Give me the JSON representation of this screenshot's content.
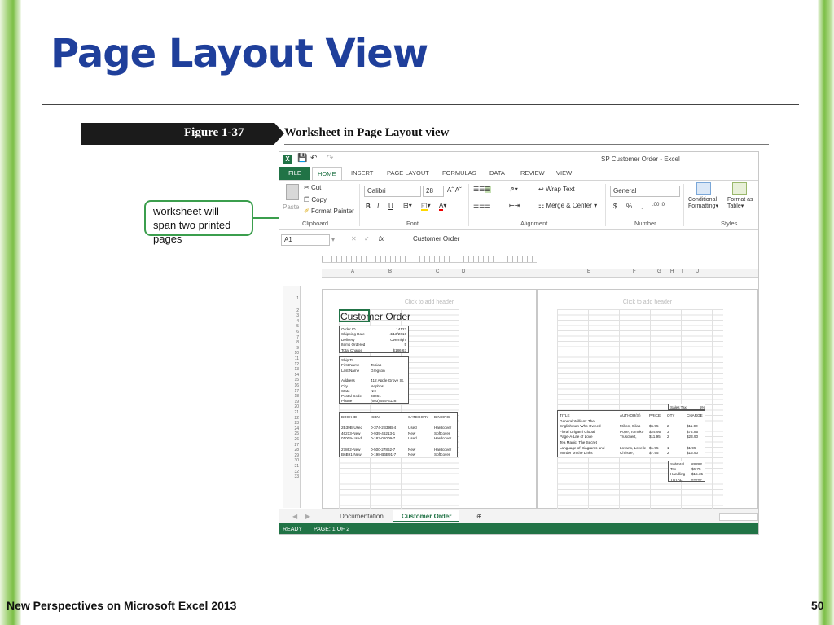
{
  "slide": {
    "title": "Page Layout View",
    "footer": "New Perspectives on Microsoft Excel 2013",
    "page_number": "50",
    "figure_number": "Figure 1-37",
    "figure_caption": "Worksheet in Page Layout view",
    "callout": "worksheet will span two printed pages"
  },
  "excel": {
    "window_title": "SP Customer Order - Excel",
    "tabs": [
      "FILE",
      "HOME",
      "INSERT",
      "PAGE LAYOUT",
      "FORMULAS",
      "DATA",
      "REVIEW",
      "VIEW"
    ],
    "clipboard": {
      "paste": "Paste",
      "cut": "Cut",
      "copy": "Copy",
      "format_painter": "Format Painter",
      "label": "Clipboard"
    },
    "font": {
      "name": "Calibri",
      "size": "28",
      "label": "Font",
      "bold": "B",
      "italic": "I",
      "underline": "U"
    },
    "alignment": {
      "wrap": "Wrap Text",
      "merge": "Merge & Center",
      "label": "Alignment"
    },
    "number": {
      "format": "General",
      "currency": "$",
      "percent": "%",
      "comma": ",",
      "label": "Number"
    },
    "styles": {
      "conditional": "Conditional",
      "formatting": "Formatting",
      "format_as": "Format as",
      "table": "Table",
      "label": "Styles"
    },
    "name_box": "A1",
    "fx": "fx",
    "formula": "Customer Order",
    "columns_left": [
      "A",
      "B",
      "C",
      "D"
    ],
    "columns_right": [
      "E",
      "F",
      "G",
      "H",
      "I",
      "J"
    ],
    "header_placeholder": "Click to add header",
    "sheet_tabs": [
      "Documentation",
      "Customer Order"
    ],
    "status": "READY",
    "page_info": "PAGE: 1 OF 2"
  },
  "worksheet": {
    "title": "Customer Order",
    "order_info": [
      [
        "Order ID",
        "14123"
      ],
      [
        "Shipping Date",
        "4/13/2016"
      ],
      [
        "Delivery",
        "Overnight"
      ],
      [
        "Items Ordered",
        "5"
      ],
      [
        "Total Charge",
        "$186.63"
      ]
    ],
    "ship_to": [
      [
        "Ship To",
        ""
      ],
      [
        "First Name",
        "Tobias"
      ],
      [
        "Last Name",
        "Gregson"
      ],
      [
        "",
        ""
      ],
      [
        "Address",
        "412 Apple Grove St."
      ],
      [
        "City",
        "Nephos"
      ],
      [
        "State",
        "NH"
      ],
      [
        "Postal Code",
        "03061"
      ],
      [
        "Phone",
        "(603) 555-4128"
      ]
    ],
    "books_header": [
      "BOOK ID",
      "ISBN",
      "CATEGORY",
      "BINDING"
    ],
    "books": [
      [
        "2B39B-Used",
        "0-374-2B39B-4",
        "Used",
        "Hardcover"
      ],
      [
        "46213-New",
        "0-939-46213-1",
        "New",
        "Softcover"
      ],
      [
        "01009-Used",
        "0-183-01009-7",
        "Used",
        "Hardcover"
      ],
      [
        "",
        ""
      ],
      [
        "27862-New",
        "0-500-27862-7",
        "New",
        "Hardcover"
      ],
      [
        "B6B91-New",
        "0-198-B6B91-7",
        "New",
        "Softcover"
      ]
    ],
    "titles_header": [
      "TITLE",
      "AUTHOR(S)",
      "PRICE",
      "QTY",
      "CHARGE"
    ],
    "titles": [
      [
        "General William: The",
        "",
        "",
        "",
        ""
      ],
      [
        "Englishman Who Owned",
        "Milton, Gilas",
        "$5.95",
        "2",
        "$11.90"
      ],
      [
        "Floral Origami Global",
        "Pope, Tomoko",
        "$24.95",
        "3",
        "$74.85"
      ],
      [
        "Page-A-Life of Love",
        "Truschert,",
        "$11.95",
        "2",
        "$23.90"
      ],
      [
        "Tea Magic: The Secret",
        "",
        "",
        "",
        ""
      ],
      [
        "Language of Diagrams and",
        "Lovano, Lovelle",
        "$1.95",
        "1",
        "$1.95"
      ],
      [
        "Murder on the Links",
        "Christie,",
        "$7.95",
        "2",
        "$15.90"
      ]
    ],
    "sales_tax": "Sales Tax",
    "sales_tax_val": "5%",
    "totals": [
      [
        "Subtotal",
        "#####"
      ],
      [
        "Tax",
        "$6.75"
      ],
      [
        "Handling",
        "$15.35"
      ],
      [
        "TOTAL",
        "#####"
      ]
    ]
  }
}
